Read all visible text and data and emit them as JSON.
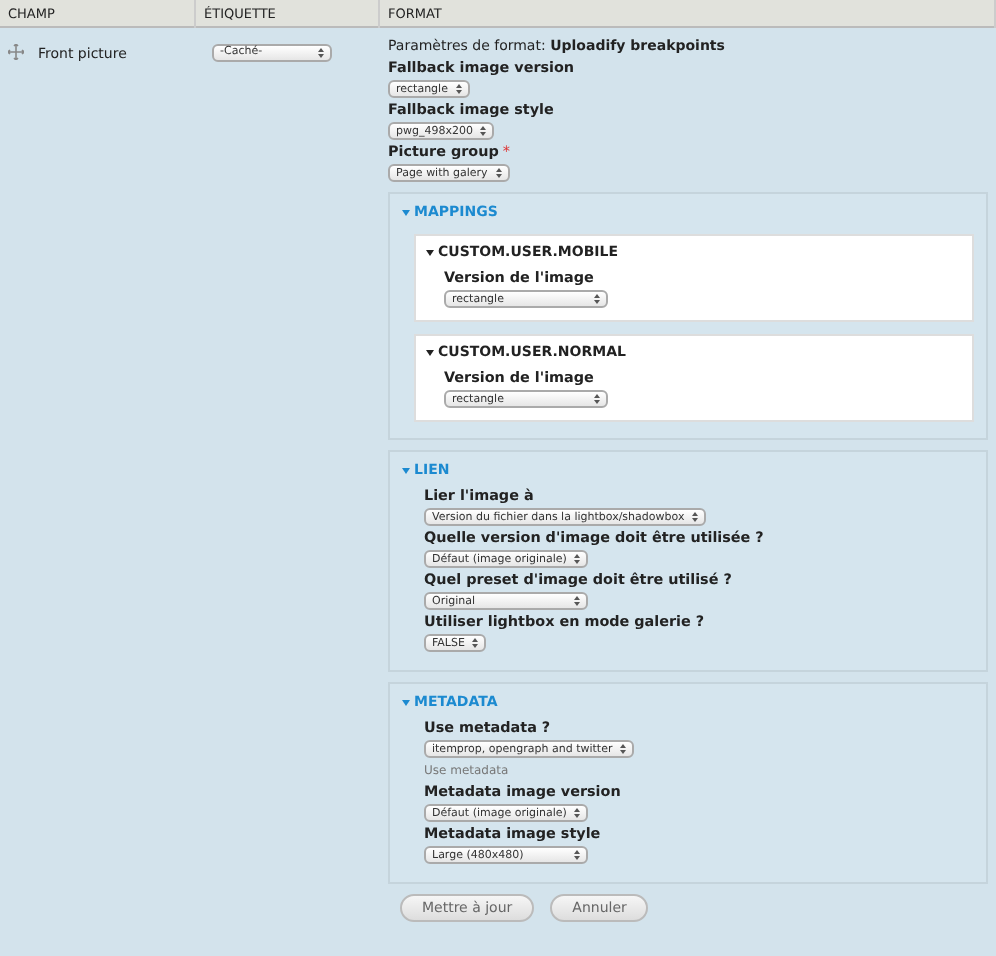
{
  "columns": [
    "CHAMP",
    "ÉTIQUETTE",
    "FORMAT"
  ],
  "row": {
    "field": "Front picture",
    "label_select": "-Caché-",
    "summary": "Paramètres de format: **Uploadify breakpoints**",
    "fields": [
      {
        "label": "Fallback image version",
        "value": "rectangle"
      },
      {
        "label": "Fallback image style",
        "value": "pwg_498x200"
      },
      {
        "label": "Picture group",
        "required_mark": "*",
        "value": "Page with galery"
      }
    ],
    "fieldsets": [
      {
        "legend": "MAPPINGS",
        "expanded": true,
        "groups": [
          {
            "legend": "CUSTOM.USER.MOBILE",
            "expanded": true,
            "fields": [
              {
                "label": "Version de l'image",
                "value": "rectangle",
                "wide": true
              }
            ]
          },
          {
            "legend": "CUSTOM.USER.NORMAL",
            "expanded": true,
            "fields": [
              {
                "label": "Version de l'image",
                "value": "rectangle",
                "wide": true
              }
            ]
          }
        ]
      },
      {
        "legend": "LIEN",
        "expanded": true,
        "fields": [
          {
            "label": "Lier l'image à",
            "value": "Version du fichier dans la lightbox/shadowbox"
          },
          {
            "label": "Quelle version d'image doit être utilisée ?",
            "value": "Défaut (image originale)"
          },
          {
            "label": "Quel preset d'image doit être utilisé ?",
            "value": "Original",
            "wide": true
          },
          {
            "label": "Utiliser lightbox en mode galerie ?",
            "value": "FALSE"
          }
        ]
      },
      {
        "legend": "METADATA",
        "expanded": true,
        "fields": [
          {
            "label": "Use metadata ?",
            "value": "itemprop, opengraph and twitter",
            "description": "Use metadata"
          },
          {
            "label": "Metadata image version",
            "value": "Défaut (image originale)"
          },
          {
            "label": "Metadata image style",
            "value": "Large (480x480)",
            "wide": true
          }
        ]
      }
    ]
  },
  "buttons": [
    "Mettre à jour",
    "Annuler"
  ]
}
